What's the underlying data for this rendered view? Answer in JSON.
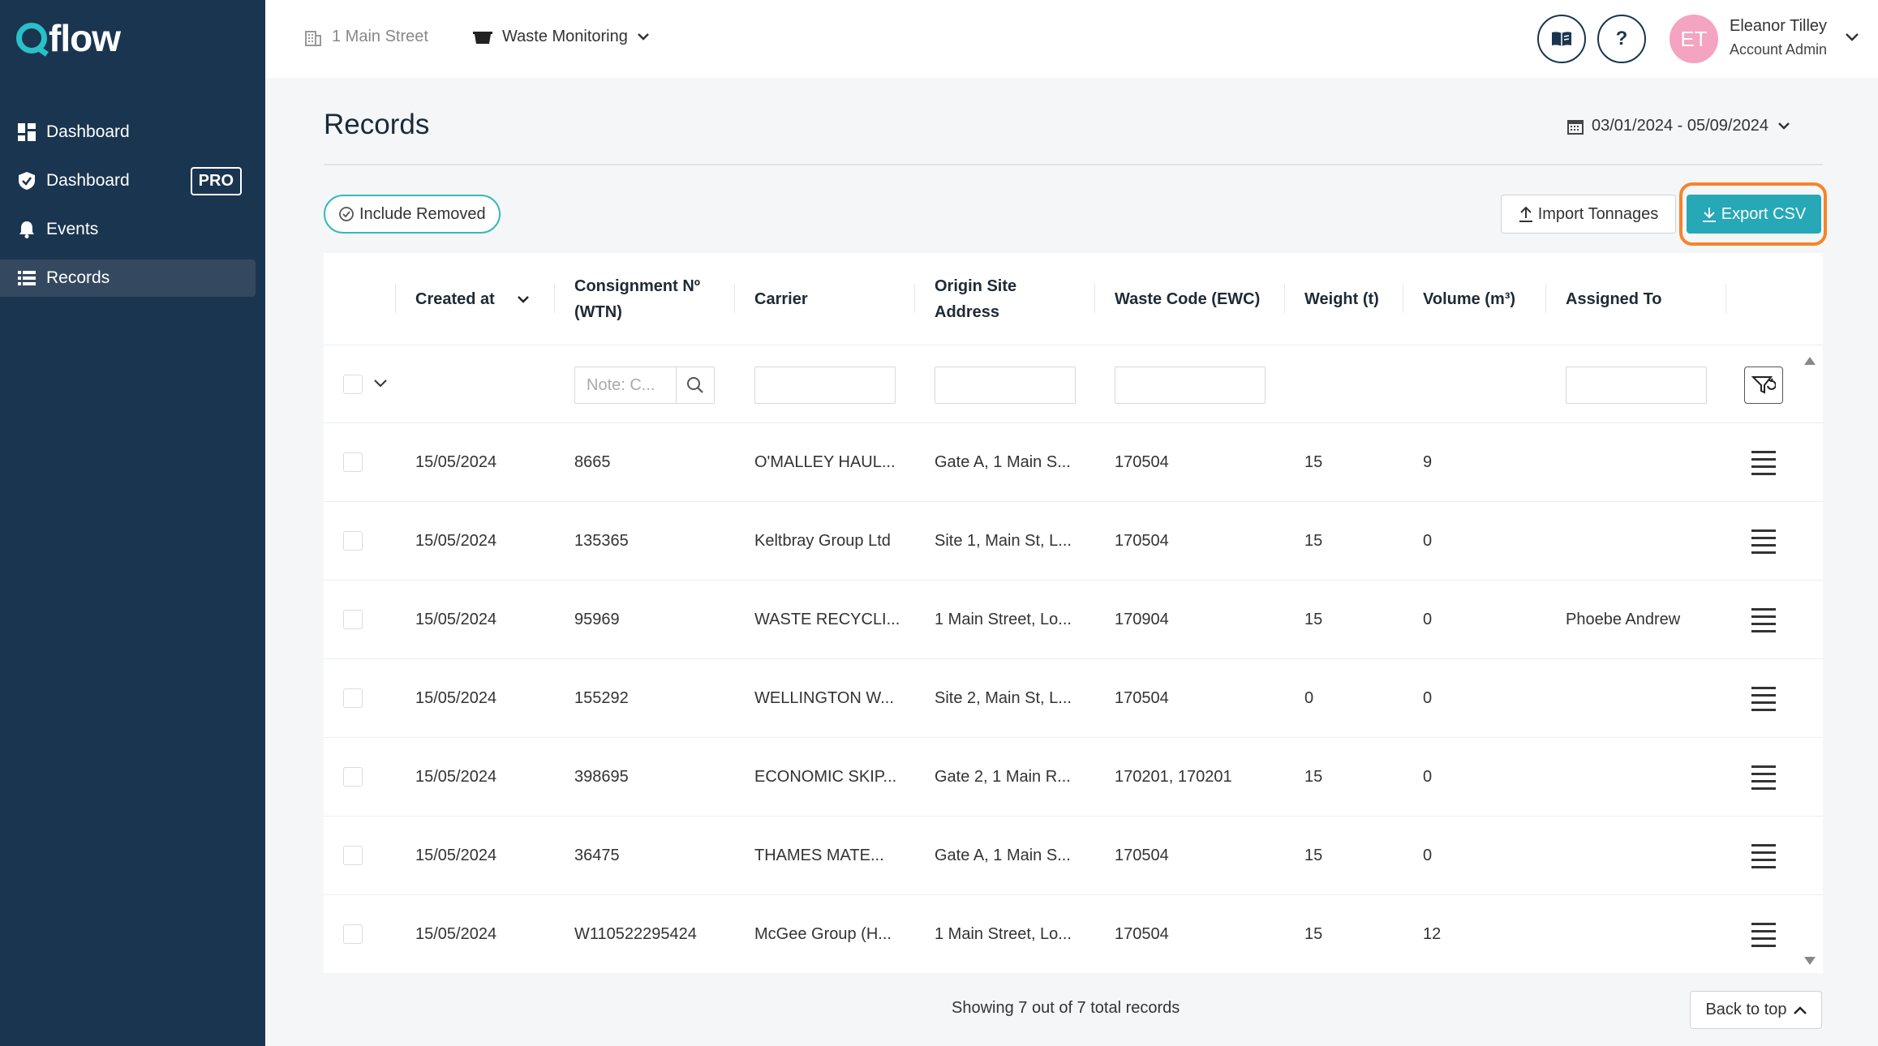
{
  "app": {
    "logo_text": "flow"
  },
  "sidebar": {
    "items": [
      {
        "label": "Dashboard",
        "icon": "dashboard-grid-icon"
      },
      {
        "label": "Dashboard",
        "icon": "shield-check-icon",
        "badge": "PRO"
      },
      {
        "label": "Events",
        "icon": "bell-icon"
      },
      {
        "label": "Records",
        "icon": "list-icon",
        "active": true
      }
    ]
  },
  "topbar": {
    "site": "1 Main Street",
    "module": "Waste Monitoring",
    "user": {
      "initials": "ET",
      "name": "Eleanor Tilley",
      "role": "Account Admin"
    },
    "help_label": "?"
  },
  "page": {
    "title": "Records",
    "date_range": "03/01/2024 - 05/09/2024",
    "include_removed_label": "Include Removed",
    "import_label": "Import Tonnages",
    "export_label": "Export CSV"
  },
  "table": {
    "headers": {
      "created_at": "Created at",
      "consignment": "Consignment Nº (WTN)",
      "carrier": "Carrier",
      "origin": "Origin Site Address",
      "waste_code": "Waste Code (EWC)",
      "weight": "Weight (t)",
      "volume": "Volume (m³)",
      "assigned": "Assigned To"
    },
    "filter_placeholder": "Note: C...",
    "rows": [
      {
        "created": "15/05/2024",
        "consignment": "8665",
        "carrier": "O'MALLEY HAUL...",
        "origin": "Gate A, 1 Main S...",
        "ewc": "170504",
        "weight": "15",
        "volume": "9",
        "assigned": ""
      },
      {
        "created": "15/05/2024",
        "consignment": "135365",
        "carrier": "Keltbray Group Ltd",
        "origin": "Site 1, Main St, L...",
        "ewc": "170504",
        "weight": "15",
        "volume": "0",
        "assigned": ""
      },
      {
        "created": "15/05/2024",
        "consignment": "95969",
        "carrier": "WASTE RECYCLI...",
        "origin": "1 Main Street, Lo...",
        "ewc": "170904",
        "weight": "15",
        "volume": "0",
        "assigned": "Phoebe Andrew"
      },
      {
        "created": "15/05/2024",
        "consignment": "155292",
        "carrier": "WELLINGTON W...",
        "origin": "Site 2, Main St, L...",
        "ewc": "170504",
        "weight": "0",
        "volume": "0",
        "assigned": ""
      },
      {
        "created": "15/05/2024",
        "consignment": "398695",
        "carrier": "ECONOMIC SKIP...",
        "origin": "Gate 2, 1 Main R...",
        "ewc": "170201, 170201",
        "weight": "15",
        "volume": "0",
        "assigned": ""
      },
      {
        "created": "15/05/2024",
        "consignment": "36475",
        "carrier": "THAMES MATE...",
        "origin": "Gate A, 1 Main S...",
        "ewc": "170504",
        "weight": "15",
        "volume": "0",
        "assigned": ""
      },
      {
        "created": "15/05/2024",
        "consignment": "W110522295424",
        "carrier": "McGee Group (H...",
        "origin": "1 Main Street, Lo...",
        "ewc": "170504",
        "weight": "15",
        "volume": "12",
        "assigned": ""
      }
    ]
  },
  "footer": {
    "showing": "Showing 7 out of 7 total records",
    "back_to_top": "Back to top"
  },
  "colors": {
    "sidebar_bg": "#1a3550",
    "accent_teal": "#26a8b7",
    "highlight_ring": "#f5842c",
    "avatar_bg": "#f4a3c0"
  }
}
